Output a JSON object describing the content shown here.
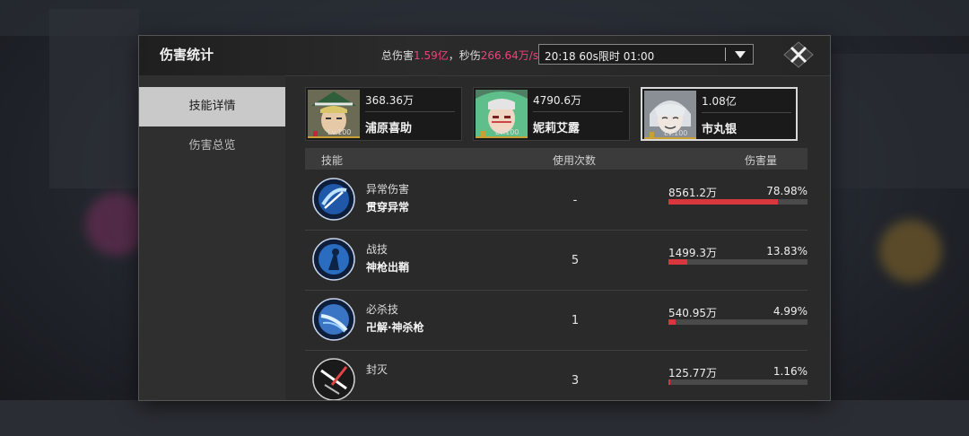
{
  "header": {
    "title": "伤害统计",
    "total_label": "总伤害",
    "total_value": "1.59亿",
    "comma": "，",
    "dps_label": "秒伤",
    "dps_value": "266.64万/s",
    "filter_selected": "20:18 60s限时 01:00"
  },
  "sidebar": {
    "items": [
      {
        "label": "技能详情",
        "active": true
      },
      {
        "label": "伤害总览",
        "active": false
      }
    ]
  },
  "characters": [
    {
      "damage": "368.36万",
      "name": "浦原喜助",
      "level": "Lv.100",
      "selected": false
    },
    {
      "damage": "4790.6万",
      "name": "妮莉艾露",
      "level": "Lv.100",
      "selected": false
    },
    {
      "damage": "1.08亿",
      "name": "市丸银",
      "level": "Lv.100",
      "selected": true
    }
  ],
  "table": {
    "headers": {
      "skill": "技能",
      "uses": "使用次数",
      "damage": "伤害量"
    },
    "rows": [
      {
        "type": "异常伤害",
        "name": "贯穿异常",
        "uses": "-",
        "damage": "8561.2万",
        "percent_label": "78.98%",
        "percent": 0.7898,
        "icon": "pierce-abnormal-icon"
      },
      {
        "type": "战技",
        "name": "神枪出鞘",
        "uses": "5",
        "damage": "1499.3万",
        "percent_label": "13.83%",
        "percent": 0.1383,
        "icon": "spear-draw-icon"
      },
      {
        "type": "必杀技",
        "name": "卍解·神杀枪",
        "uses": "1",
        "damage": "540.95万",
        "percent_label": "4.99%",
        "percent": 0.0499,
        "icon": "bankai-icon"
      },
      {
        "type": "封灭",
        "name": "",
        "uses": "3",
        "damage": "125.77万",
        "percent_label": "1.16%",
        "percent": 0.0116,
        "icon": "seal-icon"
      }
    ]
  },
  "colors": {
    "accent": "#e8467a",
    "bar": "#d8383d",
    "level_bar": "#c8a033"
  }
}
